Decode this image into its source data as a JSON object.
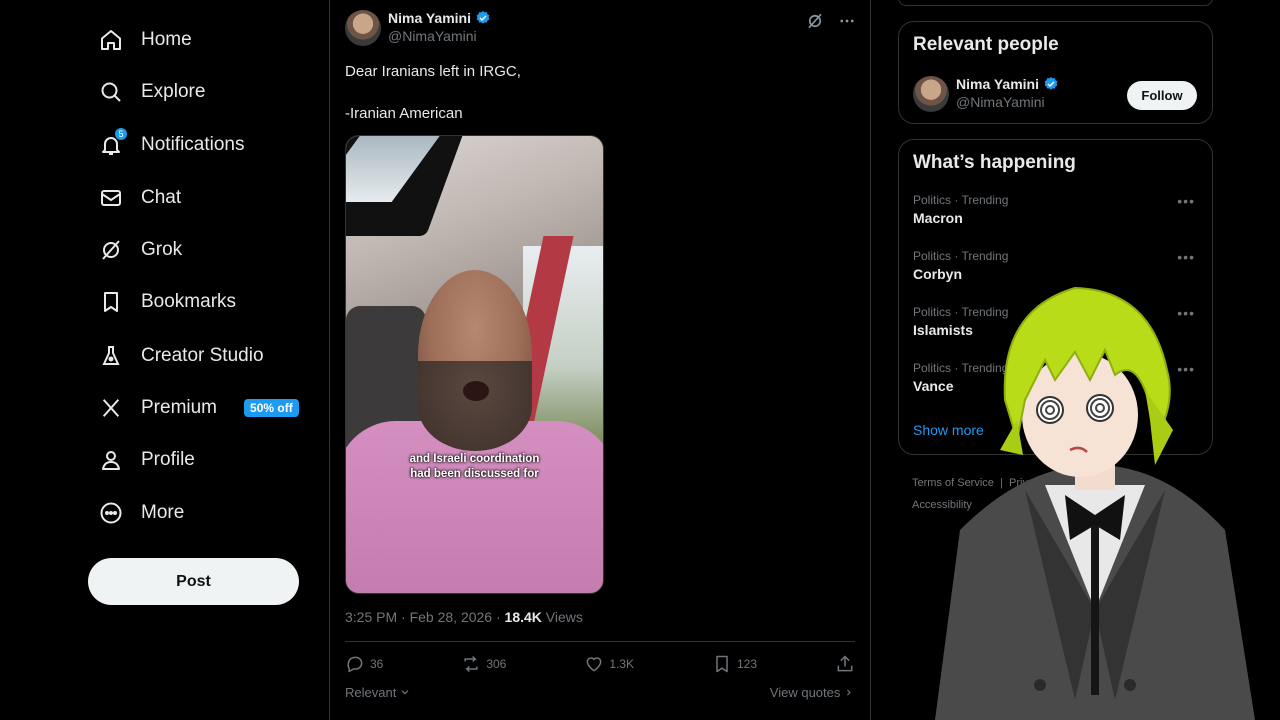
{
  "nav": {
    "items": [
      {
        "label": "Home",
        "icon": "home-icon"
      },
      {
        "label": "Explore",
        "icon": "search-icon"
      },
      {
        "label": "Notifications",
        "icon": "bell-icon",
        "badge": "5"
      },
      {
        "label": "Chat",
        "icon": "mail-icon"
      },
      {
        "label": "Grok",
        "icon": "grok-icon"
      },
      {
        "label": "Bookmarks",
        "icon": "bookmark-icon"
      },
      {
        "label": "Creator Studio",
        "icon": "flask-icon"
      },
      {
        "label": "Premium",
        "icon": "x-logo-icon",
        "promo": "50% off"
      },
      {
        "label": "Profile",
        "icon": "person-icon"
      },
      {
        "label": "More",
        "icon": "more-circle-icon"
      }
    ],
    "post_label": "Post"
  },
  "tweet": {
    "author_name": "Nima Yamini",
    "author_handle": "@NimaYamini",
    "text": "Dear Iranians left in IRGC,\n\n-Iranian American",
    "media_caption": "and Israeli coordination\nhad been discussed for",
    "time": "3:25 PM · Feb 28, 2026 · ",
    "views_count": "18.4K",
    "views_label": " Views",
    "replies": "36",
    "reposts": "306",
    "likes": "1.3K",
    "bookmarks": "123",
    "sort_label": "Relevant",
    "view_quotes": "View quotes"
  },
  "relevant_people": {
    "title": "Relevant people",
    "name": "Nima Yamini",
    "handle": "@NimaYamini",
    "follow_label": "Follow"
  },
  "whats_happening": {
    "title": "What’s happening",
    "trends": [
      {
        "category": "Politics · Trending",
        "topic": "Macron"
      },
      {
        "category": "Politics · Trending",
        "topic": "Corbyn"
      },
      {
        "category": "Politics · Trending",
        "topic": "Islamists"
      },
      {
        "category": "Politics · Trending",
        "topic": "Vance"
      }
    ],
    "show_more": "Show more"
  },
  "footer": {
    "terms": "Terms of Service",
    "privacy": "Privacy Policy",
    "accessibility": "Accessibility"
  },
  "colors": {
    "accent": "#1d9bf0",
    "background": "#000000",
    "border": "#2f3336",
    "muted": "#71767b"
  }
}
